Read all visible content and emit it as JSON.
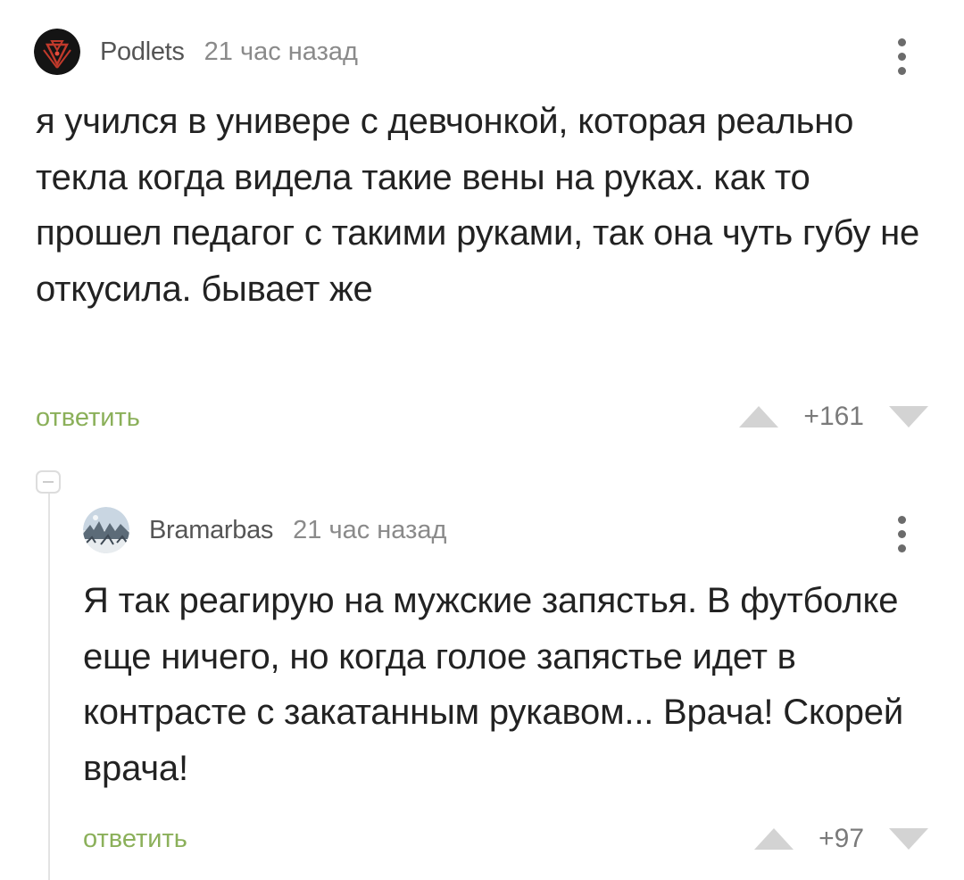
{
  "comments": [
    {
      "username": "Podlets",
      "time": "21 час назад",
      "text": "я учился в универе с девчонкой, которая реально текла когда видела такие вены на руках. как то прошел педагог с такими руками, так она чуть губу не откусила. бывает же",
      "reply_label": "ответить",
      "score": "+161"
    },
    {
      "username": "Bramarbas",
      "time": "21 час назад",
      "text": "Я так реагирую на мужские запястья. В футболке еще ничего, но когда голое запястье идет в контрасте с закатанным рукавом... Врача! Скорей врача!",
      "reply_label": "ответить",
      "score": "+97"
    }
  ],
  "colors": {
    "reply_green": "#8bb05a",
    "text": "#222222",
    "meta": "#8a8a8a",
    "username": "#555555",
    "vote_arrow": "#d0d0d0"
  },
  "icons": {
    "more": "three-dots-vertical-icon",
    "upvote": "triangle-up-icon",
    "downvote": "triangle-down-icon",
    "collapse": "minus-box-icon"
  }
}
